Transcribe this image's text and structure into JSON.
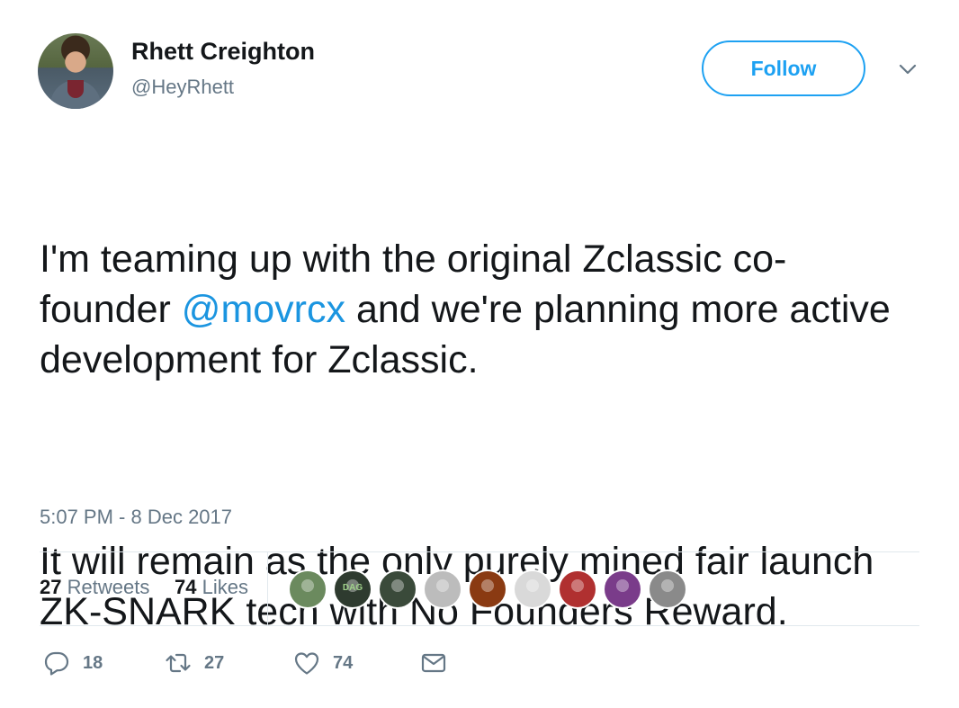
{
  "author": {
    "name": "Rhett Creighton",
    "handle": "@HeyRhett"
  },
  "follow_label": "Follow",
  "tweet": {
    "para1_prefix": "I'm teaming up with the original Zclassic co-founder ",
    "mention": "@movrcx",
    "para1_suffix": " and we're planning more active development for Zclassic.",
    "para2": "It will remain as the only purely mined fair launch ZK-SNARK tech with No Founders Reward."
  },
  "timestamp": "5:07 PM - 8 Dec 2017",
  "stats": {
    "retweets_count": "27",
    "retweets_label": "Retweets",
    "likes_count": "74",
    "likes_label": "Likes"
  },
  "actions": {
    "reply_count": "18",
    "retweet_count": "27",
    "like_count": "74"
  },
  "liker_avatars": [
    {
      "name": "liker-avatar-1",
      "color": "#6b8a5e"
    },
    {
      "name": "liker-avatar-2",
      "color": "#2e3b2f",
      "text": "DAG"
    },
    {
      "name": "liker-avatar-3",
      "color": "#3a4a3a"
    },
    {
      "name": "liker-avatar-4",
      "color": "#bcbcbc"
    },
    {
      "name": "liker-avatar-5",
      "color": "#8a3a12"
    },
    {
      "name": "liker-avatar-6",
      "color": "#d9d9d9"
    },
    {
      "name": "liker-avatar-7",
      "color": "#b03030"
    },
    {
      "name": "liker-avatar-8",
      "color": "#7a3c8a"
    },
    {
      "name": "liker-avatar-9",
      "color": "#8a8a8a"
    }
  ],
  "colors": {
    "accent": "#1da1f2",
    "mention": "#1b95e0",
    "secondary_text": "#657786",
    "primary_text": "#14171a",
    "divider": "#e1e8ed"
  }
}
